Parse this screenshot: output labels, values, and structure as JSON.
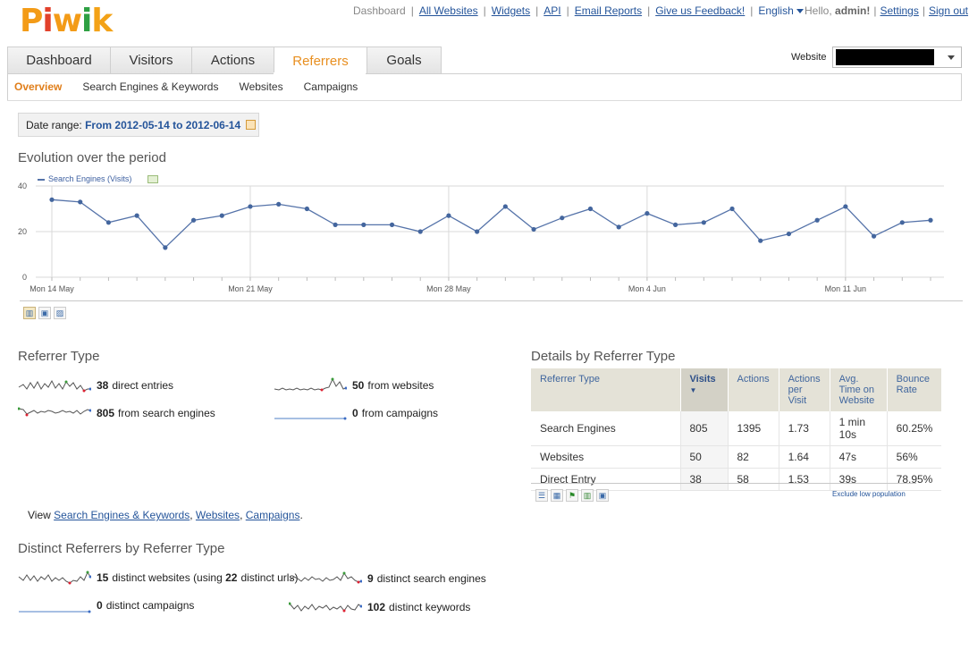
{
  "logo": [
    "P",
    "i",
    "w",
    "i",
    "k"
  ],
  "topnav": {
    "dashboard": "Dashboard",
    "links": [
      "All Websites",
      "Widgets",
      "API",
      "Email Reports",
      "Give us Feedback!"
    ],
    "language": "English",
    "hello": "Hello,",
    "user": "admin!",
    "settings": "Settings",
    "signout": "Sign out"
  },
  "tabs": [
    "Dashboard",
    "Visitors",
    "Actions",
    "Referrers",
    "Goals"
  ],
  "active_tab": "Referrers",
  "website": {
    "label": "Website"
  },
  "subnav": [
    "Overview",
    "Search Engines & Keywords",
    "Websites",
    "Campaigns"
  ],
  "date_range": {
    "label": "Date range:",
    "value": "From 2012-05-14 to 2012-06-14"
  },
  "evolution": {
    "title": "Evolution over the period",
    "legend": "Search Engines (Visits)"
  },
  "chart_data": {
    "type": "line",
    "series": [
      {
        "name": "Search Engines (Visits)",
        "values": [
          34,
          33,
          24,
          27,
          13,
          25,
          27,
          31,
          32,
          30,
          23,
          23,
          23,
          20,
          27,
          20,
          31,
          21,
          26,
          30,
          22,
          28,
          23,
          24,
          30,
          16,
          19,
          25,
          31,
          18,
          24,
          25
        ]
      }
    ],
    "x_tick_labels": [
      "Mon 14 May",
      "Mon 21 May",
      "Mon 28 May",
      "Mon 4 Jun",
      "Mon 11 Jun"
    ],
    "y_ticks": [
      0,
      20,
      40
    ],
    "ylim": [
      0,
      40
    ],
    "grid": true,
    "color": "#5573a9"
  },
  "referrer_type": {
    "title": "Referrer Type",
    "direct": {
      "value": "38",
      "text": "direct entries"
    },
    "websites": {
      "value": "50",
      "text": "from websites"
    },
    "search": {
      "value": "805",
      "text": "from search engines"
    },
    "campaigns": {
      "value": "0",
      "text": "from campaigns"
    }
  },
  "details": {
    "title": "Details by Referrer Type",
    "headers": [
      "Referrer Type",
      "Visits",
      "Actions",
      "Actions per Visit",
      "Avg. Time on Website",
      "Bounce Rate"
    ],
    "rows": [
      [
        "Search Engines",
        "805",
        "1395",
        "1.73",
        "1 min 10s",
        "60.25%"
      ],
      [
        "Websites",
        "50",
        "82",
        "1.64",
        "47s",
        "56%"
      ],
      [
        "Direct Entry",
        "38",
        "58",
        "1.53",
        "39s",
        "78.95%"
      ]
    ],
    "exclude": "Exclude low population"
  },
  "view_links": {
    "prefix": "View",
    "search": "Search Engines & Keywords",
    "websites": "Websites",
    "campaigns": "Campaigns",
    "comma": ",",
    "period": "."
  },
  "distinct": {
    "title": "Distinct Referrers by Referrer Type",
    "websites": {
      "v1": "15",
      "t1": "distinct websites (using",
      "v2": "22",
      "t2": "distinct urls)"
    },
    "search_engines": {
      "value": "9",
      "text": "distinct search engines"
    },
    "campaigns": {
      "value": "0",
      "text": "distinct campaigns"
    },
    "keywords": {
      "value": "102",
      "text": "distinct keywords"
    }
  },
  "icons": {
    "graph": [
      "bar-chart-icon",
      "save-icon",
      "image-icon"
    ],
    "table": [
      "table-icon",
      "table-more-icon",
      "goal-flag-icon",
      "bar-chart-icon",
      "save-icon"
    ]
  }
}
